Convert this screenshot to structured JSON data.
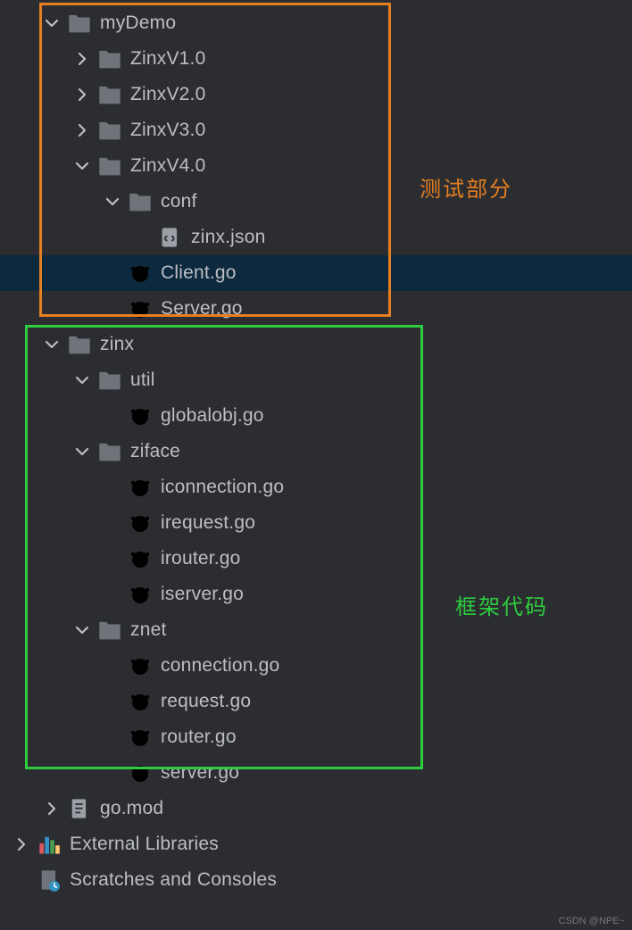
{
  "tree": {
    "myDemo": "myDemo",
    "zinxv1": "ZinxV1.0",
    "zinxv2": "ZinxV2.0",
    "zinxv3": "ZinxV3.0",
    "zinxv4": "ZinxV4.0",
    "conf": "conf",
    "zinx_json": "zinx.json",
    "client_go": "Client.go",
    "server_go_cap": "Server.go",
    "zinx": "zinx",
    "util": "util",
    "globalobj": "globalobj.go",
    "ziface": "ziface",
    "iconnection": "iconnection.go",
    "irequest": "irequest.go",
    "irouter": "irouter.go",
    "iserver": "iserver.go",
    "znet": "znet",
    "connection": "connection.go",
    "request": "request.go",
    "router": "router.go",
    "server_go": "server.go",
    "go_mod": "go.mod",
    "ext_lib": "External Libraries",
    "scratches": "Scratches and Consoles"
  },
  "annotations": {
    "orange": "测试部分",
    "green": "框架代码"
  },
  "watermark": "CSDN @NPE~"
}
